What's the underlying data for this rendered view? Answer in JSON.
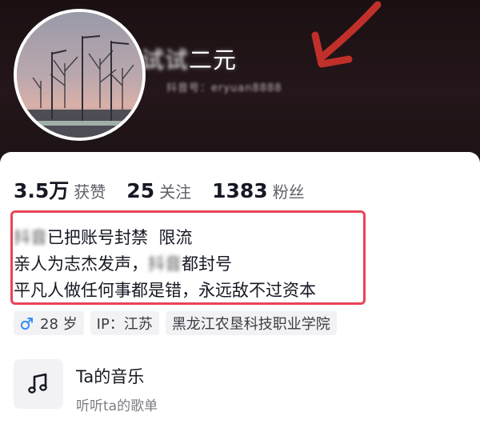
{
  "profile": {
    "nickname": "试试二元",
    "nickname_blurred": "试试",
    "nickname_visible": "二元",
    "account_id": "抖音号：eryuan8888"
  },
  "stats": [
    {
      "value": "3.5万",
      "label": "获赞"
    },
    {
      "value": "25",
      "label": "关注"
    },
    {
      "value": "1383",
      "label": "粉丝"
    }
  ],
  "bio": {
    "line1_blurred": "抖音",
    "line1_rest": "已把账号封禁  限流",
    "line2_pre": "亲人为志杰发声，",
    "line2_blurred": "抖音",
    "line2_post": "都封号",
    "line3": "平凡人做任何事都是错，永远敌不过资本"
  },
  "tags": {
    "age": "28 岁",
    "ip": "IP：江苏",
    "school": "黑龙江农垦科技职业学院"
  },
  "music": {
    "title": "Ta的音乐",
    "subtitle": "听听ta的歌单"
  },
  "colors": {
    "highlight_border": "#e8445a",
    "male_icon": "#3a8ff2",
    "arrow": "#c0302a"
  },
  "icons": {
    "male": "male-icon",
    "music": "music-note-icon"
  }
}
